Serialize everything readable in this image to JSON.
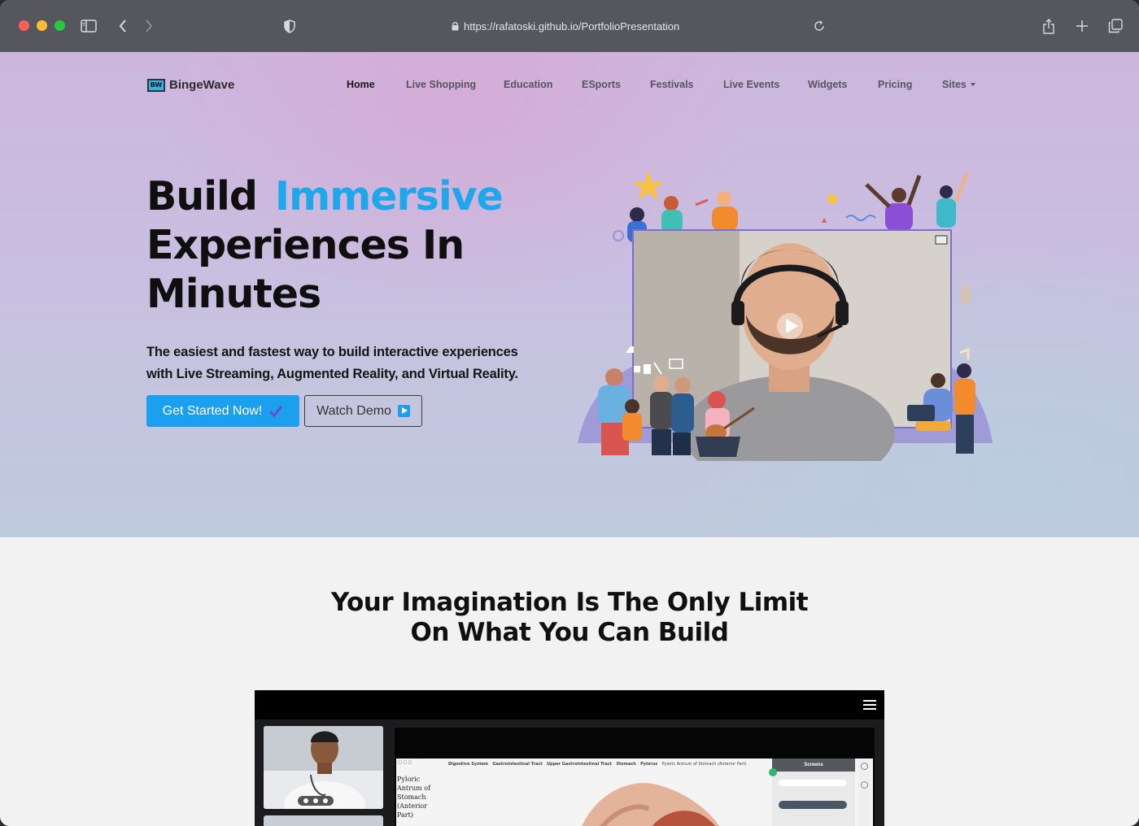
{
  "browser": {
    "url": "https://rafatoski.github.io/PortfolioPresentation",
    "icons": [
      "sidebar-icon",
      "back-icon",
      "forward-icon",
      "shield-icon",
      "lock-icon",
      "reload-icon",
      "share-icon",
      "new-tab-icon",
      "tabs-overview-icon"
    ]
  },
  "site": {
    "logo_mark": "BW",
    "logo_text": "BingeWave",
    "nav": [
      {
        "label": "Home",
        "active": true
      },
      {
        "label": "Live Shopping"
      },
      {
        "label": "Education"
      },
      {
        "label": "ESports"
      },
      {
        "label": "Festivals"
      },
      {
        "label": "Live Events"
      },
      {
        "label": "Widgets"
      },
      {
        "label": "Pricing"
      },
      {
        "label": "Sites",
        "dropdown": true
      }
    ]
  },
  "hero": {
    "headline_word1": "Build",
    "headline_accent": "Immersive",
    "headline_line2": "Experiences In",
    "headline_line3": "Minutes",
    "lead_line1": "The easiest and fastest way to build interactive experiences",
    "lead_line2": "with Live Streaming, Augmented Reality, and Virtual Reality.",
    "primary_button": "Get Started Now!",
    "secondary_button": "Watch Demo",
    "accent_color": "#1fa7ec",
    "button_color": "#1d9ff0"
  },
  "section2": {
    "title_line1": "Your Imagination Is The Only Limit",
    "title_line2": "On What You Can Build",
    "app_preview": {
      "breadcrumb": [
        "Digestive System",
        "Gastrointestinal Tract",
        "Upper Gastrointestinal Tract",
        "Stomach",
        "Pylorus",
        "Pyloric Antrum of Stomach (Anterior Part)"
      ],
      "organ_label": [
        "Pyloric",
        "Antrum of",
        "Stomach",
        "(Anterior",
        "Part)"
      ],
      "panel_title": "Screens"
    }
  }
}
